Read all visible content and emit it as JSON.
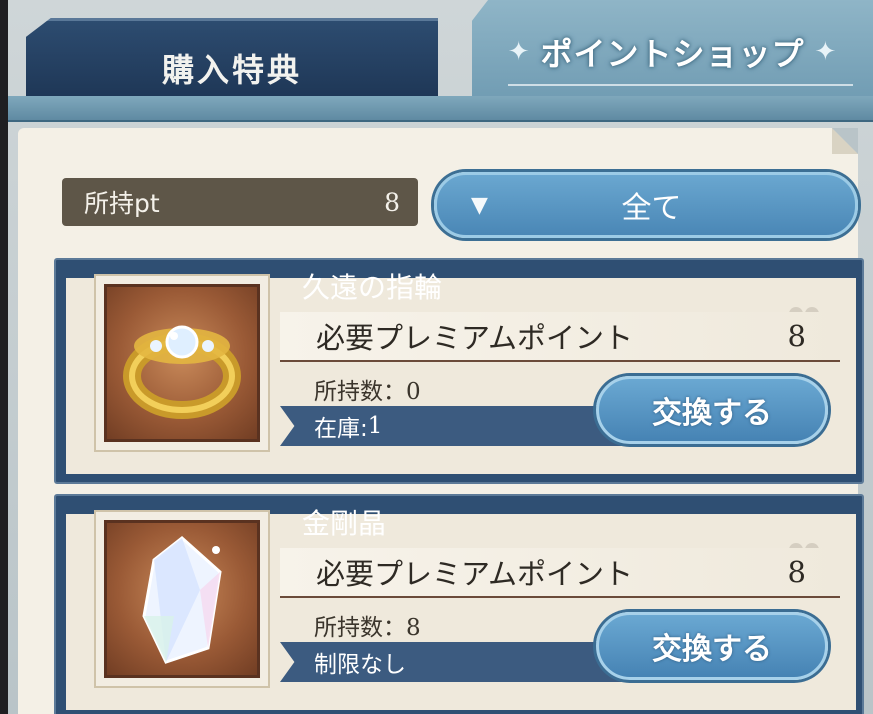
{
  "tabs": [
    {
      "label": "購入特典",
      "active": false
    },
    {
      "label": "ポイントショップ",
      "active": true
    }
  ],
  "points": {
    "label": "所持pt",
    "value": "8"
  },
  "filter": {
    "label": "全て"
  },
  "items": [
    {
      "name": "久遠の指輪",
      "required_label": "必要プレミアムポイント",
      "required_value": "8",
      "owned_label": "所持数：",
      "owned_value": "0",
      "stock_text": "在庫: ",
      "stock_value": "1",
      "button_label": "交換する",
      "icon": "ring-icon"
    },
    {
      "name": "金剛晶",
      "required_label": "必要プレミアムポイント",
      "required_value": "8",
      "owned_label": "所持数：",
      "owned_value": "8",
      "stock_text": "制限なし",
      "stock_value": "",
      "button_label": "交換する",
      "icon": "crystal-icon"
    }
  ],
  "colors": {
    "accent_blue": "#4a87b6",
    "card_navy": "#2f4f73",
    "panel_cream": "#f4f0e6"
  }
}
